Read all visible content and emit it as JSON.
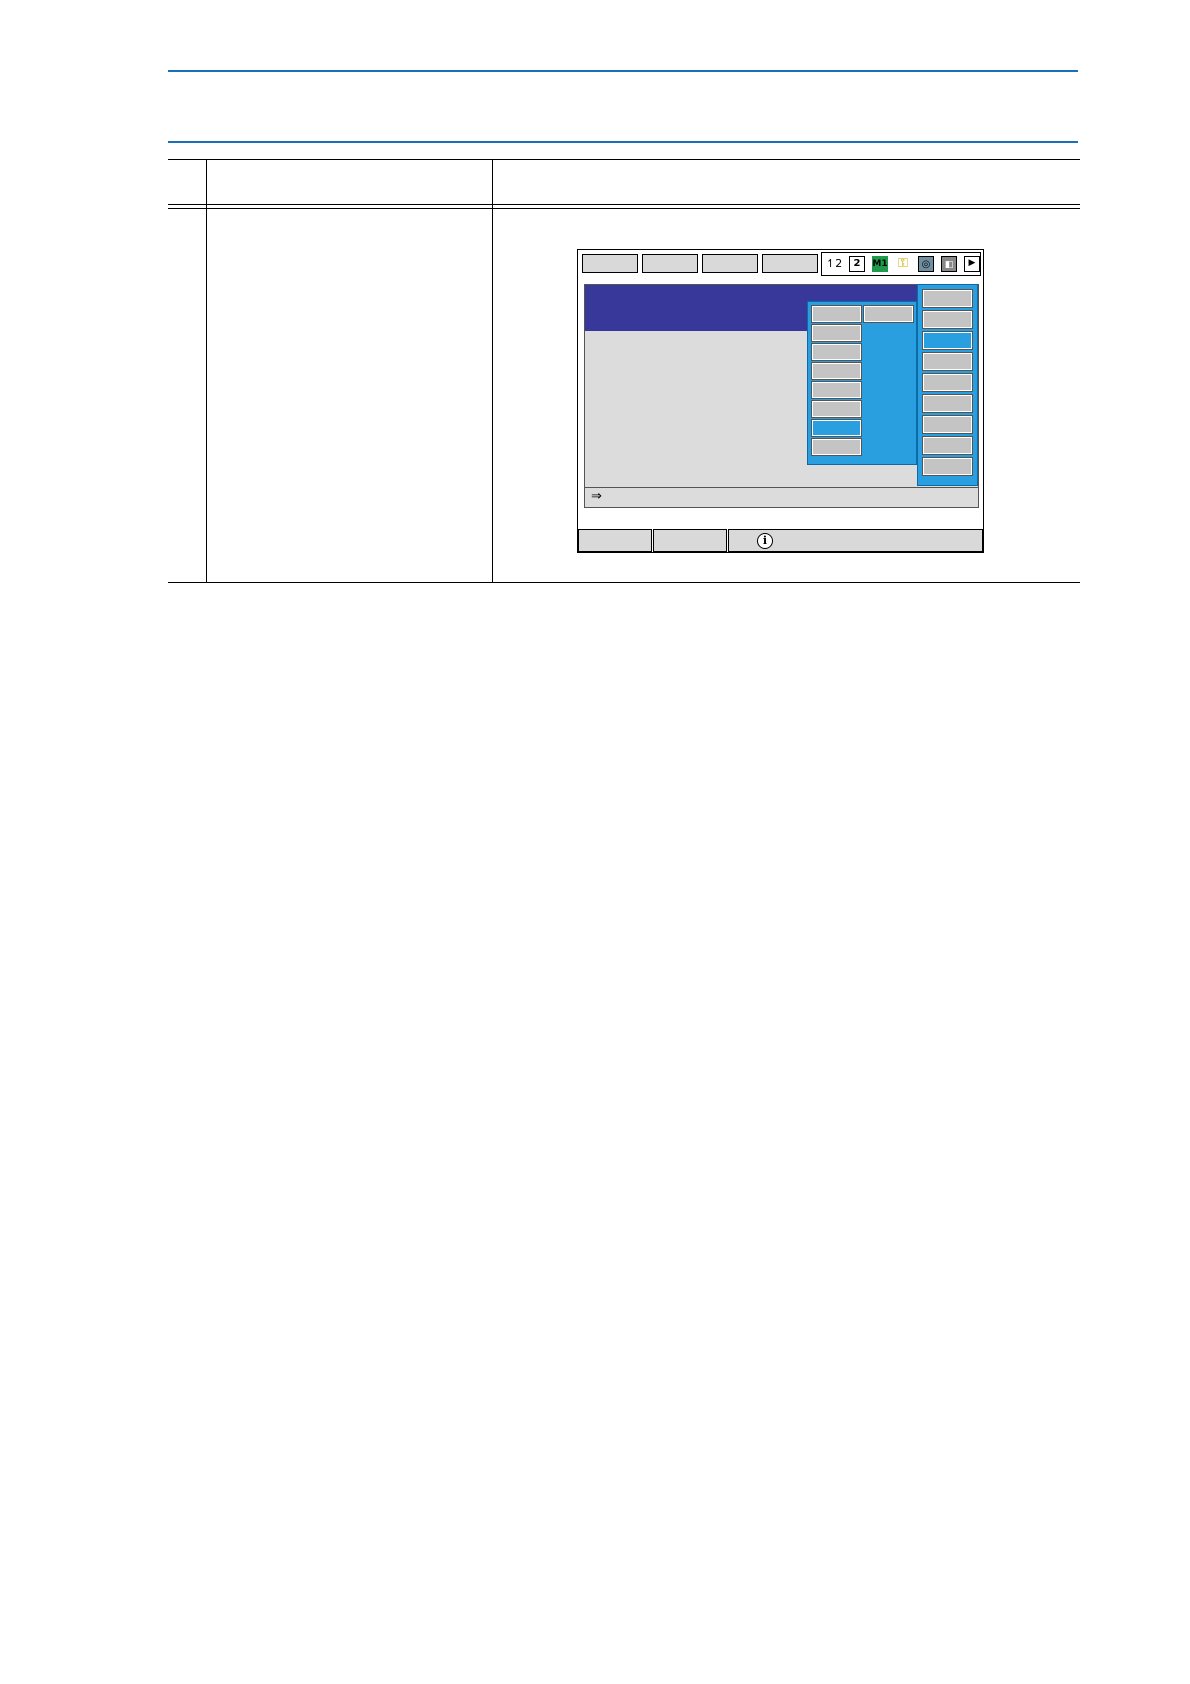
{
  "document": {
    "header_title": "",
    "table": {
      "col_headers": [
        "",
        "",
        ""
      ],
      "row_step": "",
      "row_operation": "",
      "row_explanation": ""
    }
  },
  "pendant_screen": {
    "top_tabs": [
      "",
      "",
      "",
      ""
    ],
    "status_icons": [
      "one-two-icon",
      "frame-2-icon",
      "coordinate-icon",
      "key-icon",
      "camera-icon",
      "teach-mode-icon",
      "play-icon"
    ],
    "command_line_prompt": "⇒",
    "submenu": {
      "items": [
        "",
        "",
        "",
        "",
        "",
        "",
        "",
        ""
      ],
      "selected_index": 6
    },
    "right_menu": {
      "items": [
        "",
        "",
        "",
        "",
        "",
        "",
        "",
        "",
        ""
      ],
      "selected_index": 2
    },
    "bottom_buttons": [
      "",
      ""
    ],
    "info_icon": "ⓘ",
    "message": "",
    "colors": {
      "title_bar": "#38389a",
      "menu_blue": "#2a9fe0",
      "button_gray": "#c4c4c4",
      "pane_gray": "#dcdcdc"
    }
  }
}
